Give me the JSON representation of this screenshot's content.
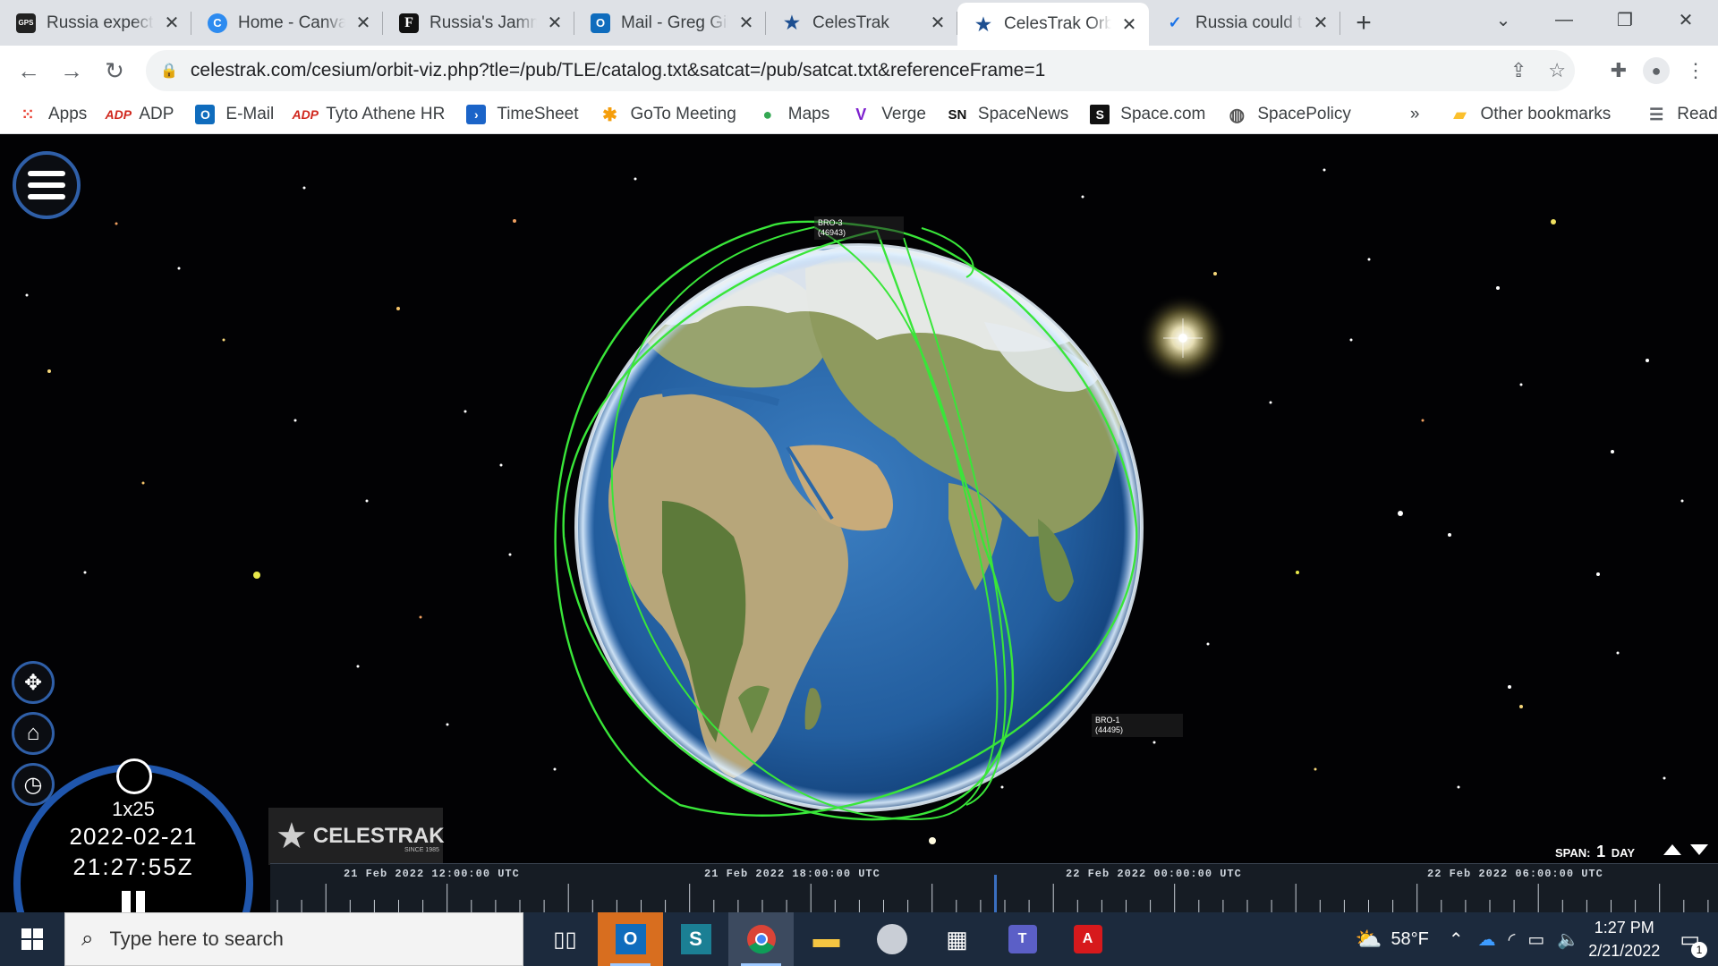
{
  "browser": {
    "tabs": [
      {
        "title": "Russia expected to",
        "favicon": "gps-world-icon",
        "active": false
      },
      {
        "title": "Home - Canva",
        "favicon": "canva-icon",
        "active": false
      },
      {
        "title": "Russia's Jamming",
        "favicon": "forbes-icon",
        "active": false
      },
      {
        "title": "Mail - Greg Gillinger",
        "favicon": "outlook-icon",
        "active": false
      },
      {
        "title": "CelesTrak",
        "favicon": "celestrak-icon",
        "active": false
      },
      {
        "title": "CelesTrak Orbit Visualization",
        "favicon": "celestrak-icon",
        "active": true
      },
      {
        "title": "Russia could target",
        "favicon": "checkmark-icon",
        "active": false
      }
    ],
    "url_host": "celestrak.com",
    "url_path": "/cesium/orbit-viz.php?tle=/pub/TLE/catalog.txt&satcat=/pub/satcat.txt&referenceFrame=1",
    "bookmarks": [
      {
        "label": "Apps",
        "icon": "apps-grid-icon"
      },
      {
        "label": "ADP",
        "icon": "adp-icon"
      },
      {
        "label": "E-Mail",
        "icon": "outlook-icon"
      },
      {
        "label": "Tyto Athene HR",
        "icon": "adp-icon"
      },
      {
        "label": "TimeSheet",
        "icon": "timesheet-icon"
      },
      {
        "label": "GoTo Meeting",
        "icon": "goto-icon"
      },
      {
        "label": "Maps",
        "icon": "maps-pin-icon"
      },
      {
        "label": "Verge",
        "icon": "verge-icon"
      },
      {
        "label": "SpaceNews",
        "icon": "spacenews-icon"
      },
      {
        "label": "Space.com",
        "icon": "spacecom-icon"
      },
      {
        "label": "SpacePolicy",
        "icon": "globe-icon"
      }
    ],
    "bookmarks_overflow": "»",
    "other_bookmarks": "Other bookmarks",
    "reading_list": "Reading list"
  },
  "app": {
    "sat_labels": [
      {
        "name": "BRO-3",
        "id": "(46943)"
      },
      {
        "name": "BRO-1",
        "id": "(44495)"
      }
    ],
    "clock": {
      "multiplier": "1x25",
      "date": "2022-02-21",
      "time": "21:27:55Z"
    },
    "brand": "CELESTRAK",
    "brand_since": "SINCE 1985",
    "span_label": "SPAN:",
    "span_value": "1",
    "span_unit": "DAY",
    "timeline_labels": [
      "21 Feb 2022 12:00:00 UTC",
      "21 Feb 2022 18:00:00 UTC",
      "22 Feb 2022 00:00:00 UTC",
      "22 Feb 2022 06:00:00 UTC"
    ],
    "orbit_color": "#39e639",
    "accent_color": "#2f5fa8"
  },
  "taskbar": {
    "search_placeholder": "Type here to search",
    "weather": "58°F",
    "time": "1:27 PM",
    "date": "2/21/2022",
    "notification_count": "1",
    "apps": [
      "task-view-icon",
      "outlook-icon",
      "sharepoint-icon",
      "chrome-icon",
      "file-explorer-icon",
      "app-pro-icon",
      "calculator-icon",
      "teams-icon",
      "acrobat-icon"
    ]
  }
}
